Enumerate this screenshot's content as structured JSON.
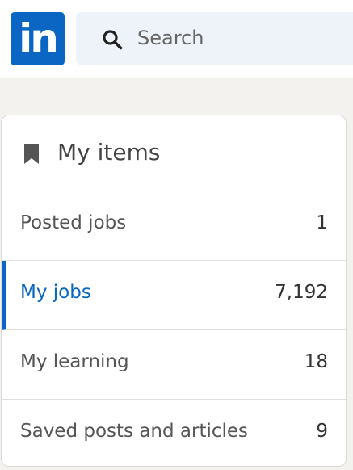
{
  "header": {
    "logo_text": "in",
    "search": {
      "placeholder": "Search",
      "icon": "search-icon"
    }
  },
  "my_items": {
    "title": "My items",
    "icon": "bookmark-icon",
    "accent_color": "#0a66c2",
    "items": [
      {
        "label": "Posted jobs",
        "count": "1",
        "active": false
      },
      {
        "label": "My jobs",
        "count": "7,192",
        "active": true
      },
      {
        "label": "My learning",
        "count": "18",
        "active": false
      },
      {
        "label": "Saved posts and articles",
        "count": "9",
        "active": false
      }
    ]
  }
}
